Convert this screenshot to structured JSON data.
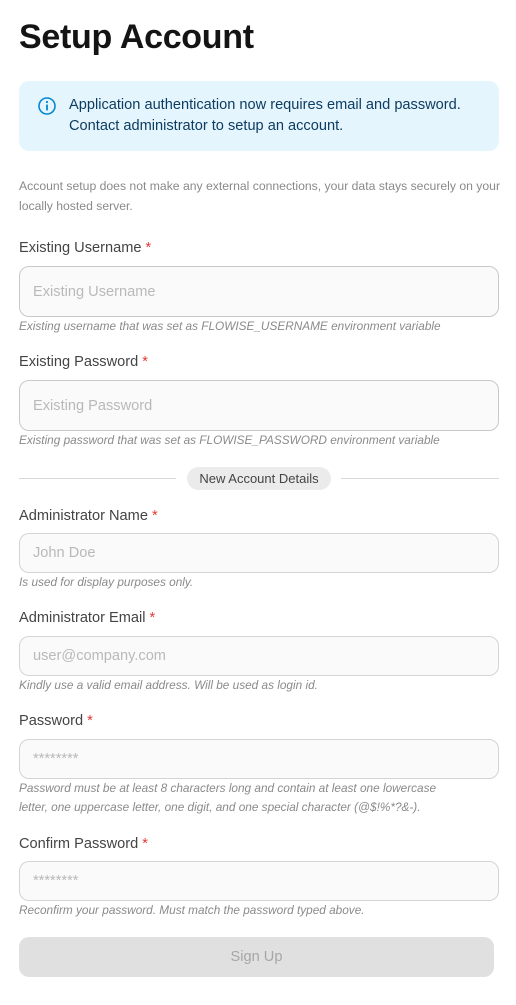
{
  "page": {
    "title": "Setup Account"
  },
  "alert": {
    "icon": "info-icon",
    "color": "#0288d1",
    "text_line1": "Application authentication now requires email and password.",
    "text_line2": "Contact administrator to setup an account."
  },
  "note": "Account setup does not make any external connections, your data stays securely on your locally hosted server.",
  "existing_username": {
    "label": "Existing Username",
    "required": "*",
    "placeholder": "Existing Username",
    "value": "",
    "hint": "Existing username that was set as FLOWISE_USERNAME environment variable"
  },
  "existing_password": {
    "label": "Existing Password",
    "required": "*",
    "placeholder": "Existing Password",
    "value": "",
    "hint": "Existing password that was set as FLOWISE_PASSWORD environment variable"
  },
  "divider": {
    "label": "New Account Details"
  },
  "admin_name": {
    "label": "Administrator Name",
    "required": "*",
    "placeholder": "John Doe",
    "value": "",
    "hint": "Is used for display purposes only."
  },
  "admin_email": {
    "label": "Administrator Email",
    "required": "*",
    "placeholder": "user@company.com",
    "value": "",
    "hint": "Kindly use a valid email address. Will be used as login id."
  },
  "password": {
    "label": "Password",
    "required": "*",
    "placeholder": "********",
    "value": "",
    "hint_line1": "Password must be at least 8 characters long and contain at least one lowercase",
    "hint_line2": "letter, one uppercase letter, one digit, and one special character (@$!%*?&-)."
  },
  "confirm_password": {
    "label": "Confirm Password",
    "required": "*",
    "placeholder": "********",
    "value": "",
    "hint": "Reconfirm your password. Must match the password typed above."
  },
  "signup_button": {
    "label": "Sign Up",
    "state": "disabled"
  }
}
